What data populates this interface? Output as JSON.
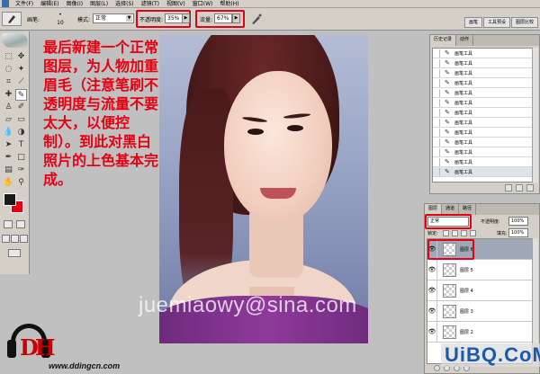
{
  "menu": {
    "items": [
      "文件(F)",
      "编辑(E)",
      "图像(I)",
      "图层(L)",
      "选择(S)",
      "滤镜(T)",
      "视图(V)",
      "窗口(W)",
      "帮助(H)"
    ]
  },
  "options_bar": {
    "brush_label": "画笔:",
    "brush_size": "10",
    "mode_label": "模式:",
    "mode_value": "正常",
    "opacity_label": "不透明度:",
    "opacity_value": "35%",
    "flow_label": "流量:",
    "flow_value": "67%",
    "panel_tabs": [
      "画笔",
      "工具预设",
      "图层比较"
    ]
  },
  "instruction": "最后新建一个正常图层，为人物加重眉毛（注意笔刷不透明度与流量不要太大，以便控制）。到此对黑白照片的上色基本完成。",
  "watermark": "juemiaowy@sina.com",
  "logo": {
    "mark": "DH",
    "url": "www.ddingcn.com"
  },
  "history_panel": {
    "tabs": [
      "历史记录",
      "动作"
    ],
    "items": [
      "画笔工具",
      "画笔工具",
      "画笔工具",
      "画笔工具",
      "画笔工具",
      "画笔工具",
      "画笔工具",
      "画笔工具",
      "画笔工具",
      "画笔工具",
      "画笔工具",
      "画笔工具",
      "画笔工具"
    ]
  },
  "layers_panel": {
    "tabs": [
      "图层",
      "通道",
      "路径"
    ],
    "mode_value": "正常",
    "opacity_label": "不透明度:",
    "opacity_value": "100%",
    "lock_label": "锁定:",
    "fill_label": "填充:",
    "fill_value": "100%",
    "layers": [
      "图层 6",
      "图层 5",
      "图层 4",
      "图层 3",
      "图层 2"
    ]
  },
  "site_logo": "UiBQ.CoM",
  "colors": {
    "highlight": "#e60012",
    "foreground": "#1b1b1b",
    "background": "#e60012"
  }
}
